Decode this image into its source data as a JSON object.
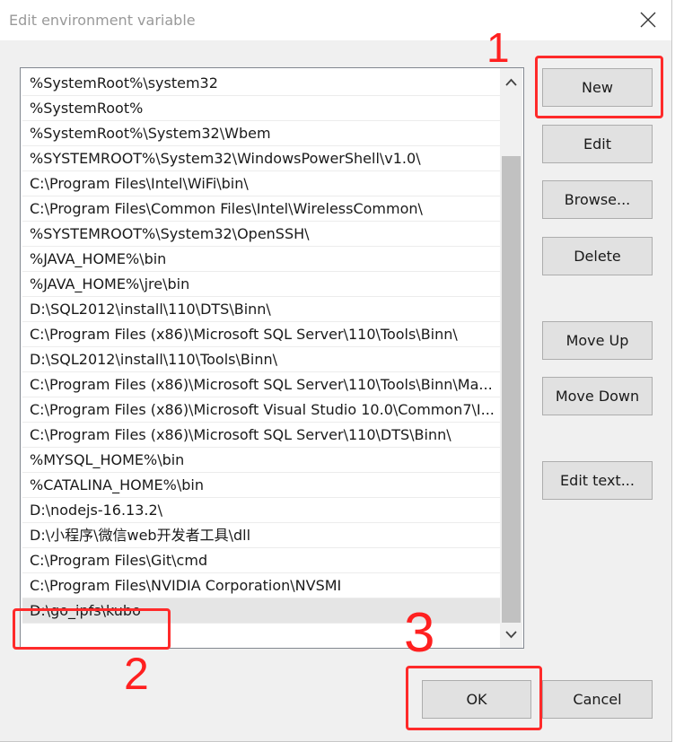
{
  "window": {
    "title": "Edit environment variable"
  },
  "list": {
    "items": [
      "%SystemRoot%\\system32",
      "%SystemRoot%",
      "%SystemRoot%\\System32\\Wbem",
      "%SYSTEMROOT%\\System32\\WindowsPowerShell\\v1.0\\",
      "C:\\Program Files\\Intel\\WiFi\\bin\\",
      "C:\\Program Files\\Common Files\\Intel\\WirelessCommon\\",
      "%SYSTEMROOT%\\System32\\OpenSSH\\",
      "%JAVA_HOME%\\bin",
      "%JAVA_HOME%\\jre\\bin",
      "D:\\SQL2012\\install\\110\\DTS\\Binn\\",
      "C:\\Program Files (x86)\\Microsoft SQL Server\\110\\Tools\\Binn\\",
      "D:\\SQL2012\\install\\110\\Tools\\Binn\\",
      "C:\\Program Files (x86)\\Microsoft SQL Server\\110\\Tools\\Binn\\Ma...",
      "C:\\Program Files (x86)\\Microsoft Visual Studio 10.0\\Common7\\I...",
      "C:\\Program Files (x86)\\Microsoft SQL Server\\110\\DTS\\Binn\\",
      "%MYSQL_HOME%\\bin",
      "%CATALINA_HOME%\\bin",
      "D:\\nodejs-16.13.2\\",
      "D:\\小程序\\微信web开发者工具\\dll",
      "C:\\Program Files\\Git\\cmd",
      "C:\\Program Files\\NVIDIA Corporation\\NVSMI",
      "D:\\go_ipfs\\kubo"
    ],
    "selected_index": 21
  },
  "buttons": {
    "new": "New",
    "edit": "Edit",
    "browse": "Browse...",
    "delete": "Delete",
    "move_up": "Move Up",
    "move_down": "Move Down",
    "edit_text": "Edit text...",
    "ok": "OK",
    "cancel": "Cancel"
  },
  "annotations": {
    "step1": "1",
    "step2": "2",
    "step3": "3",
    "color": "#ff2a2a"
  },
  "icons": {
    "close": "close-icon",
    "scroll_up": "chevron-up-icon",
    "scroll_down": "chevron-down-icon"
  }
}
